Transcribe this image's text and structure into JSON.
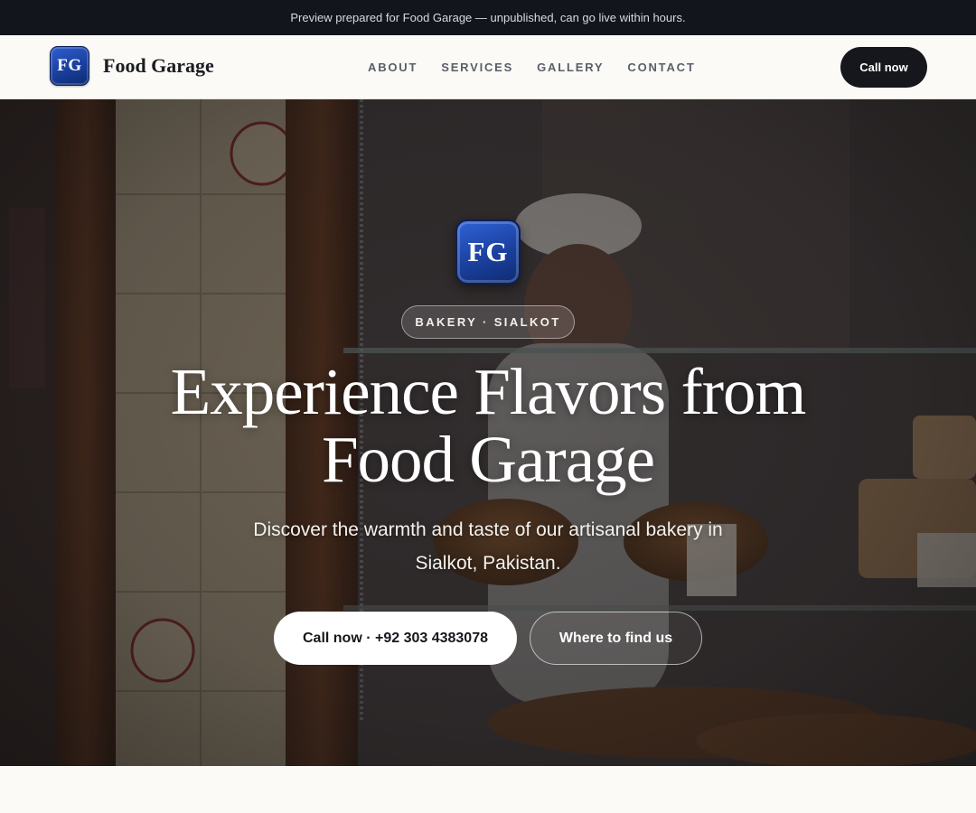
{
  "preview_bar": {
    "text": "Preview prepared for Food Garage — unpublished, can go live within hours."
  },
  "header": {
    "logo_initials": "FG",
    "brand_name": "Food Garage",
    "nav": [
      {
        "label": "ABOUT"
      },
      {
        "label": "SERVICES"
      },
      {
        "label": "GALLERY"
      },
      {
        "label": "CONTACT"
      }
    ],
    "cta_label": "Call now"
  },
  "hero": {
    "logo_initials": "FG",
    "tag": "BAKERY · SIALKOT",
    "title": "Experience Flavors from Food Garage",
    "subtitle": "Discover the warmth and taste of our artisanal bakery in Sialkot, Pakistan.",
    "primary_button": "Call now · +92 303 4383078",
    "secondary_button": "Where to find us",
    "image_description": "bakery-window-photo"
  },
  "colors": {
    "preview_bar_bg": "#12151b",
    "nav_bg": "#fbfaf6",
    "cta_bg": "#15171c",
    "logo_blue": "#1b419f",
    "hero_text": "#ffffff"
  }
}
